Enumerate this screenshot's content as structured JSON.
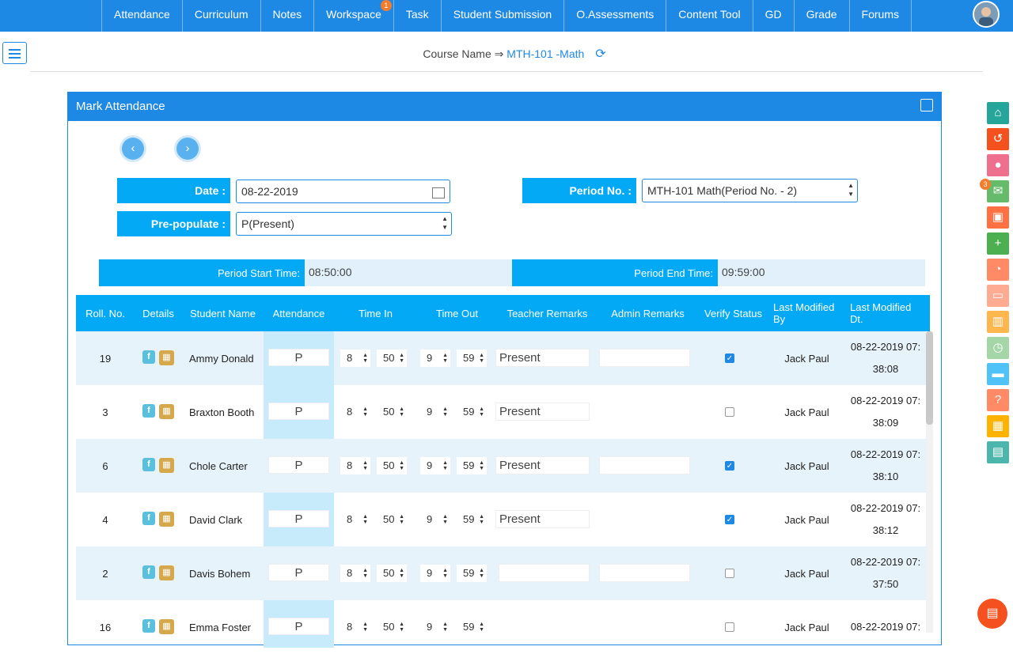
{
  "nav": {
    "tabs": [
      {
        "label": "Attendance"
      },
      {
        "label": "Curriculum"
      },
      {
        "label": "Notes"
      },
      {
        "label": "Workspace",
        "badge": "1"
      },
      {
        "label": "Task"
      },
      {
        "label": "Student Submission"
      },
      {
        "label": "O.Assessments"
      },
      {
        "label": "Content Tool"
      },
      {
        "label": "GD"
      },
      {
        "label": "Grade"
      },
      {
        "label": "Forums"
      }
    ]
  },
  "course": {
    "prefix": "Course Name ⇒",
    "name": "MTH-101 -Math",
    "refresh_icon": "refresh-icon"
  },
  "panel": {
    "title": "Mark Attendance",
    "expand_icon": "expand-icon"
  },
  "pager": {
    "prev": "‹",
    "next": "›"
  },
  "form": {
    "date_label": "Date :",
    "date_value": "08-22-2019",
    "period_label": "Period No. :",
    "period_value": "MTH-101 Math(Period No. - 2)",
    "prepop_label": "Pre-populate :",
    "prepop_value": "P(Present)"
  },
  "times": {
    "start_label": "Period Start Time:",
    "start_value": "08:50:00",
    "end_label": "Period End Time:",
    "end_value": "09:59:00"
  },
  "table": {
    "headers": [
      "Roll. No.",
      "Details",
      "Student Name",
      "Attendance",
      "Time In",
      "Time Out",
      "Teacher Remarks",
      "Admin Remarks",
      "Verify Status",
      "Last Modified By",
      "Last Modified Dt."
    ],
    "rows": [
      {
        "roll": "19",
        "name": "Ammy Donald",
        "att": "P",
        "in_h": "8",
        "in_m": "50",
        "out_h": "9",
        "out_m": "59",
        "tremark": "Present",
        "verified": true,
        "by": "Jack Paul",
        "dt1": "08-22-2019 07:",
        "dt2": "38:08"
      },
      {
        "roll": "3",
        "name": "Braxton Booth",
        "att": "P",
        "in_h": "8",
        "in_m": "50",
        "out_h": "9",
        "out_m": "59",
        "tremark": "Present",
        "verified": false,
        "by": "Jack Paul",
        "dt1": "08-22-2019 07:",
        "dt2": "38:09"
      },
      {
        "roll": "6",
        "name": "Chole Carter",
        "att": "P",
        "in_h": "8",
        "in_m": "50",
        "out_h": "9",
        "out_m": "59",
        "tremark": "Present",
        "verified": true,
        "by": "Jack Paul",
        "dt1": "08-22-2019 07:",
        "dt2": "38:10"
      },
      {
        "roll": "4",
        "name": "David Clark",
        "att": "P",
        "in_h": "8",
        "in_m": "50",
        "out_h": "9",
        "out_m": "59",
        "tremark": "Present",
        "verified": true,
        "by": "Jack Paul",
        "dt1": "08-22-2019 07:",
        "dt2": "38:12"
      },
      {
        "roll": "2",
        "name": "Davis Bohem",
        "att": "P",
        "in_h": "8",
        "in_m": "50",
        "out_h": "9",
        "out_m": "59",
        "tremark": "",
        "verified": false,
        "by": "Jack Paul",
        "dt1": "08-22-2019 07:",
        "dt2": "37:50"
      },
      {
        "roll": "16",
        "name": "Emma Foster",
        "att": "P",
        "in_h": "8",
        "in_m": "50",
        "out_h": "9",
        "out_m": "59",
        "tremark": "",
        "verified": false,
        "by": "Jack Paul",
        "dt1": "08-22-2019 07:",
        "dt2": ""
      }
    ]
  },
  "sidebar": {
    "items": [
      {
        "icon": "home-icon",
        "color": "#26a69a",
        "glyph": "⌂"
      },
      {
        "icon": "undo-icon",
        "color": "#f4511e",
        "glyph": "↺"
      },
      {
        "icon": "user-circle-icon",
        "color": "#ef6f8e",
        "glyph": "●"
      },
      {
        "icon": "mail-icon",
        "color": "#66bb6a",
        "glyph": "✉",
        "badge": "3"
      },
      {
        "icon": "contact-card-icon",
        "color": "#ff7043",
        "glyph": "▣"
      },
      {
        "icon": "monitor-plus-icon",
        "color": "#4caf50",
        "glyph": "+"
      },
      {
        "icon": "gauge-icon",
        "color": "#ff8a65",
        "glyph": "◔"
      },
      {
        "icon": "card-icon",
        "color": "#ffab91",
        "glyph": "▭"
      },
      {
        "icon": "bar-chart-icon",
        "color": "#ffb74d",
        "glyph": "▥"
      },
      {
        "icon": "clock-icon",
        "color": "#a5d6a7",
        "glyph": "◷"
      },
      {
        "icon": "folder-icon",
        "color": "#4fc3f7",
        "glyph": "▬"
      },
      {
        "icon": "help-icon",
        "color": "#ff8a65",
        "glyph": "?"
      },
      {
        "icon": "calendar-icon",
        "color": "#ffb300",
        "glyph": "▦"
      },
      {
        "icon": "book-icon",
        "color": "#4db6ac",
        "glyph": "▤"
      }
    ]
  },
  "fab": {
    "icon": "report-icon"
  }
}
